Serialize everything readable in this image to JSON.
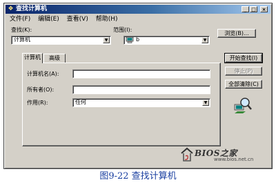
{
  "window": {
    "title": "查找计算机",
    "controls": {
      "minimize": "_",
      "maximize": "□",
      "close": "×"
    }
  },
  "menu": {
    "items": [
      "文件(F)",
      "编辑(E)",
      "查看(V)",
      "帮助(H)"
    ]
  },
  "search": {
    "find_label": "查找(K):",
    "find_value": "计算机",
    "scope_label": "范围(I):",
    "scope_value": "b",
    "browse_button": "浏览(B)..."
  },
  "tabs": [
    "计算机",
    "高级"
  ],
  "form": {
    "computer_name_label": "计算机名(A):",
    "computer_name_value": "",
    "owner_label": "所有者(O):",
    "owner_value": "",
    "role_label": "作用(R):",
    "role_value": "任何"
  },
  "buttons": {
    "start": "开始查找(I)",
    "stop": "停止(P)",
    "clear": "全部清除(C)"
  },
  "caption": "图9-22   查找计算机",
  "watermark": {
    "text": "BIOS之家",
    "url": "www.bios.net.cn"
  },
  "icons": {
    "title": "search-computer-icon",
    "scope": "computer-icon",
    "find_animation": "magnifier-icon"
  },
  "colors": {
    "titlebar_start": "#0a246a",
    "titlebar_end": "#a6caf0",
    "caption": "#1a3fa0"
  }
}
